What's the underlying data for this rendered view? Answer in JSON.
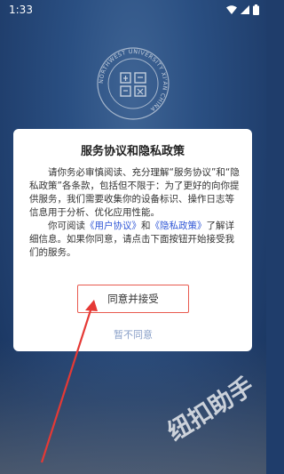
{
  "status_bar": {
    "time": "1:33",
    "icons": [
      "wifi-icon",
      "signal-icon",
      "battery-icon"
    ]
  },
  "background": {
    "emblem_text": "NORTHWEST UNIVERSITY XI'AN CHINA",
    "emblem_icon": "university-emblem-icon"
  },
  "dialog": {
    "title": "服务协议和隐私政策",
    "para1": "请你务必审慎阅读、充分理解“服务协议”和“隐私政策”各条款，包括但不限于：为了更好的向你提供服务，我们需要收集你的设备标识、操作日志等信息用于分析、优化应用性能。",
    "para2_prefix": "你可阅读",
    "user_agreement_link": "《用户协议》",
    "and": "和",
    "privacy_policy_link": "《隐私政策》",
    "para2_suffix": "了解详细信息。如果你同意，请点击下面按钮开始接受我们的服务。",
    "accept_label": "同意并接受",
    "decline_label": "暂不同意"
  },
  "annotation": {
    "arrow_color": "#e53935",
    "highlight_color": "#e85a4f"
  },
  "watermark": {
    "text": "纽扣助手"
  },
  "colors": {
    "background": "#1f3d6b",
    "link": "#2f56d6",
    "decline": "#8aa0c8"
  }
}
